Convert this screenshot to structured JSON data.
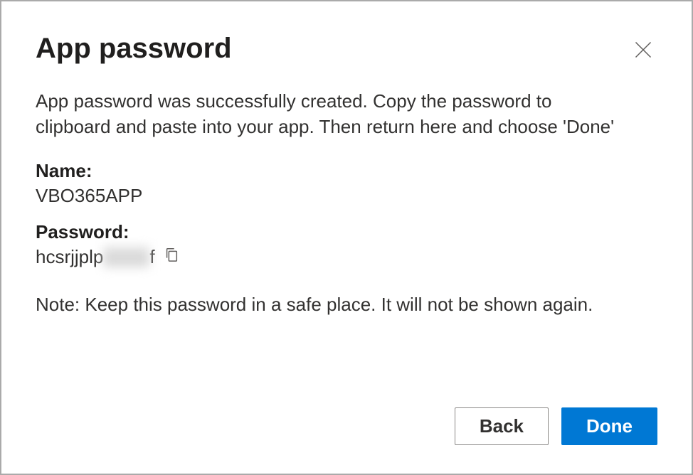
{
  "dialog": {
    "title": "App password",
    "description": "App password was successfully created. Copy the password to clipboard and paste into your app. Then return here and choose 'Done'",
    "fields": {
      "name_label": "Name:",
      "name_value": "VBO365APP",
      "password_label": "Password:",
      "password_prefix": "hcsrjjplp",
      "password_blurred": "xxxxx",
      "password_suffix": "f"
    },
    "note": "Note: Keep this password in a safe place. It will not be shown again.",
    "buttons": {
      "back": "Back",
      "done": "Done"
    }
  }
}
